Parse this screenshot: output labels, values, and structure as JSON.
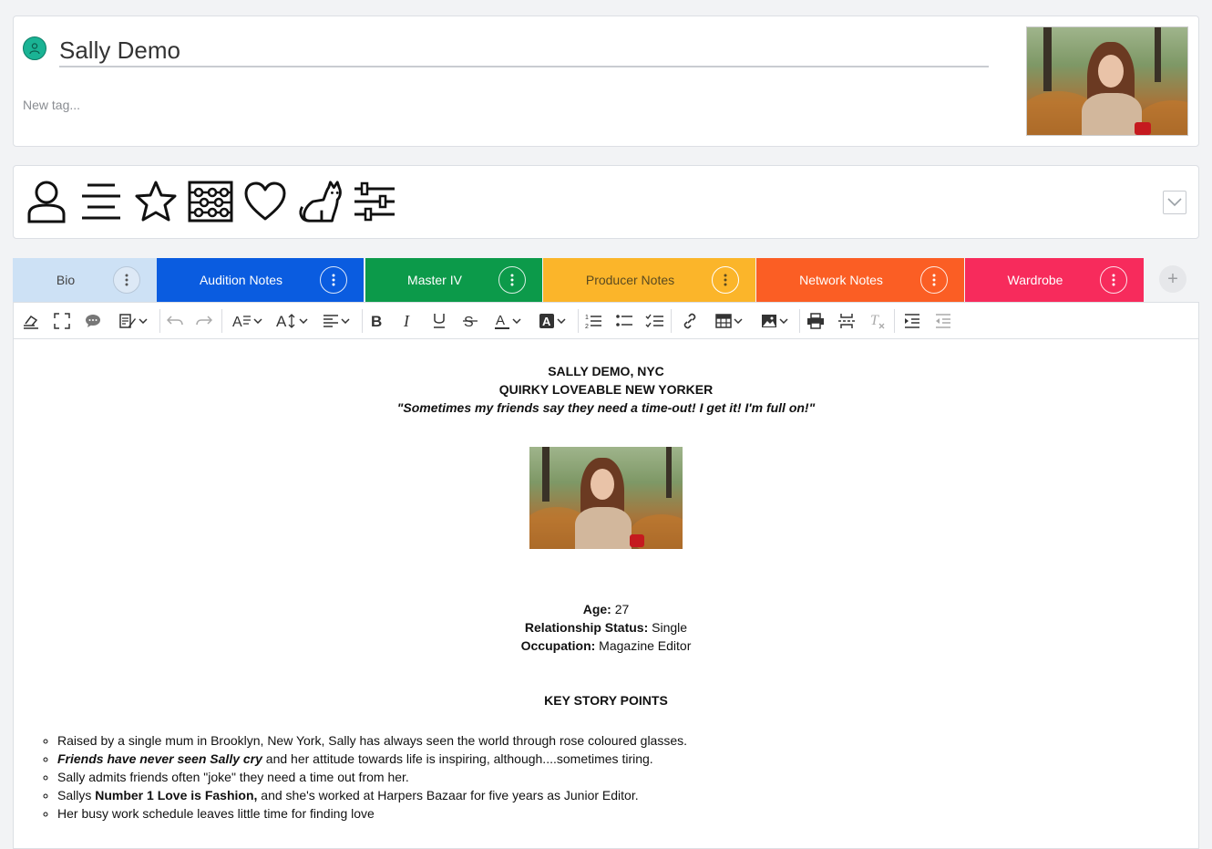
{
  "header": {
    "name_value": "Sally Demo",
    "tag_placeholder": "New tag..."
  },
  "category_icons": [
    "person-icon",
    "lines-icon",
    "star-icon",
    "abacus-icon",
    "heart-icon",
    "cat-icon",
    "sliders-icon"
  ],
  "tabs": [
    {
      "label": "Bio",
      "color": "#cde1f5",
      "text_color": "#444444",
      "active": true
    },
    {
      "label": "Audition Notes",
      "color": "#0a5ce0",
      "text_color": "#ffffff"
    },
    {
      "label": "Master IV",
      "color": "#0c9a4a",
      "text_color": "#ffffff"
    },
    {
      "label": "Producer Notes",
      "color": "#fbb52a",
      "text_color": "#5a4a20"
    },
    {
      "label": "Network Notes",
      "color": "#fb5e24",
      "text_color": "#ffffff"
    },
    {
      "label": "Wardrobe",
      "color": "#f72b5c",
      "text_color": "#ffffff"
    }
  ],
  "tab_add_label": "+",
  "doc": {
    "heading1": "SALLY DEMO, NYC",
    "heading2": "QUIRKY LOVEABLE NEW YORKER",
    "quote": "\"Sometimes my friends say they need a time-out! I get it! I'm full on!\"",
    "age_label": "Age:",
    "age_value": " 27",
    "relationship_label": "Relationship Status:",
    "relationship_value": " Single",
    "occupation_label": "Occupation:",
    "occupation_value": " Magazine Editor",
    "key_points_title": "KEY STORY POINTS",
    "point1": "Raised by a single mum in Brooklyn, New York, Sally has always seen the world through rose coloured glasses.",
    "point2_emph": "Friends have never seen Sally cry",
    "point2_rest": " and her attitude towards life is inspiring, although....sometimes tiring.",
    "point3": "Sally admits friends often \"joke\" they need a time out from her.",
    "point4_pre": "Sallys ",
    "point4_bold": "Number 1 Love is Fashion,",
    "point4_rest": " and she's worked at Harpers Bazaar for five years as Junior Editor.",
    "point5": "Her busy work schedule leaves little time for finding love"
  },
  "colors": {
    "accent_teal": "#1ab394",
    "page_bg": "#f2f3f5"
  }
}
